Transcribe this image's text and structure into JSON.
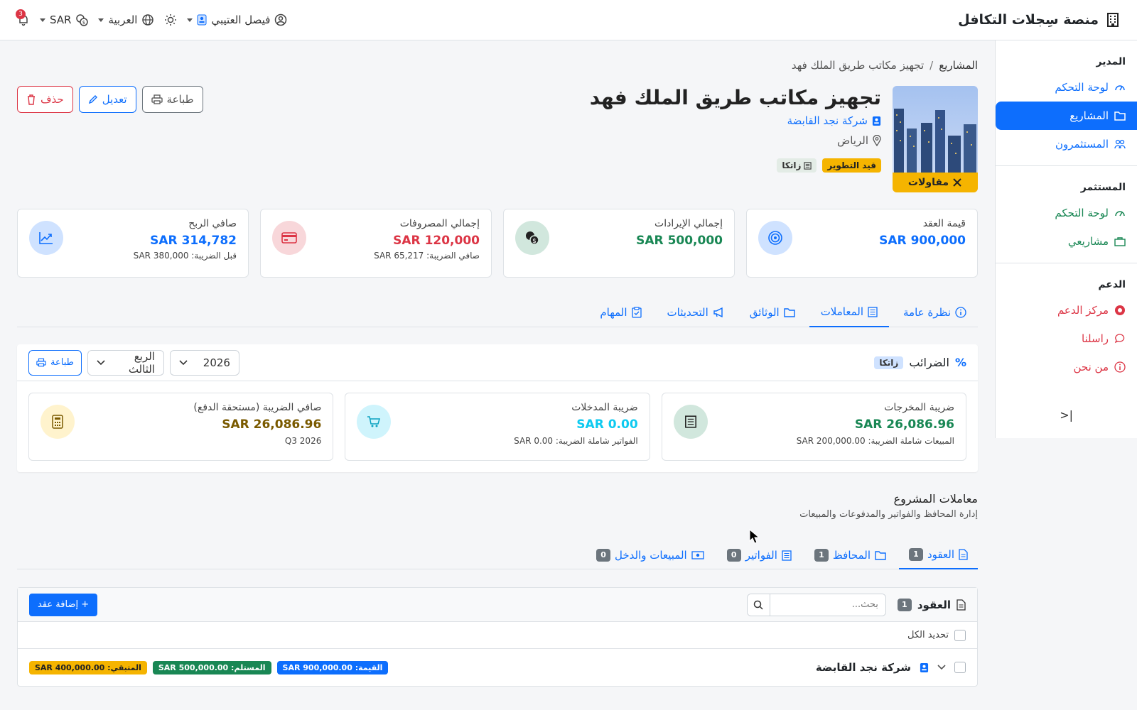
{
  "app": {
    "name": "منصة سِجلات التكافل",
    "user_name": "فيصل العتيبي",
    "language": "العربية",
    "currency": "SAR",
    "notifications_count": "3"
  },
  "sidebar": {
    "sections": [
      {
        "title": "المدير",
        "items": [
          {
            "label": "لوحة التحكم"
          },
          {
            "label": "المشاريع"
          },
          {
            "label": "المستثمرون"
          }
        ]
      },
      {
        "title": "المستثمر",
        "items": [
          {
            "label": "لوحة التحكم"
          },
          {
            "label": "مشاريعي"
          }
        ]
      },
      {
        "title": "الدعم",
        "items": [
          {
            "label": "مركز الدعم"
          },
          {
            "label": "راسلنا"
          },
          {
            "label": "من نحن"
          }
        ]
      }
    ],
    "collapse_label": "|<"
  },
  "breadcrumb": {
    "root": "المشاريع",
    "separator": "/",
    "current": "تجهيز مكاتب طريق الملك فهد"
  },
  "project": {
    "title": "تجهيز مكاتب طريق الملك فهد",
    "company": "شركة نجد القابضة",
    "city": "الرياض",
    "status_badge": "قيد التطوير",
    "zakat_badge": "زاتكا",
    "category_ribbon": "مقاولات"
  },
  "actions": {
    "print": "طباعة",
    "edit": "تعديل",
    "delete": "حذف"
  },
  "stats": [
    {
      "label": "قيمة العقد",
      "value": "900,000 SAR",
      "sub": "",
      "color": "#0d6efd"
    },
    {
      "label": "إجمالي الإيرادات",
      "value": "500,000 SAR",
      "sub": "",
      "color": "#198754"
    },
    {
      "label": "إجمالي المصروفات",
      "value": "120,000 SAR",
      "sub": "صافي الضريبة: 65,217 SAR",
      "color": "#dc3545"
    },
    {
      "label": "صافي الربح",
      "value": "314,782 SAR",
      "sub": "قبل الضريبة: 380,000 SAR",
      "color": "#0d6efd"
    }
  ],
  "tabs": [
    {
      "label": "نظرة عامة"
    },
    {
      "label": "المعاملات"
    },
    {
      "label": "الوثائق"
    },
    {
      "label": "التحديثات"
    },
    {
      "label": "المهام"
    }
  ],
  "tax": {
    "title": "الضرائب",
    "tag": "زاتكا",
    "year": "2026",
    "quarter": "الربع الثالث",
    "print": "طباعة",
    "cards": [
      {
        "label": "ضريبة المخرجات",
        "value": "26,086.96 SAR",
        "sub": "المبيعات شاملة الضريبة: 200,000.00 SAR",
        "color": "#198754"
      },
      {
        "label": "ضريبة المدخلات",
        "value": "0.00 SAR",
        "sub": "الفواتير شاملة الضريبة: 0.00 SAR",
        "color": "#0dcaf0"
      },
      {
        "label": "صافي الضريبة (مستحقة الدفع)",
        "value": "26,086.96 SAR",
        "sub": "Q3 2026",
        "color": "#7a5a00"
      }
    ]
  },
  "transactions": {
    "title": "معاملات المشروع",
    "subtitle": "إدارة المحافظ والفواتير والمدفوعات والمبيعات",
    "subtabs": [
      {
        "label": "العقود",
        "count": "1"
      },
      {
        "label": "المحافظ",
        "count": "1"
      },
      {
        "label": "الفواتير",
        "count": "0"
      },
      {
        "label": "المبيعات والدخل",
        "count": "0"
      }
    ],
    "panel_title": "العقود",
    "panel_count": "1",
    "search_placeholder": "بحث...",
    "add_button": "+ إضافة عقد",
    "select_all": "تحديد الكل",
    "rows": [
      {
        "name": "شركة نجد القابضة",
        "value_pill": "القيمة: 900,000.00 SAR",
        "received_pill": "المستلم: 500,000.00 SAR",
        "remaining_pill": "المتبقي: 400,000.00 SAR"
      }
    ]
  }
}
